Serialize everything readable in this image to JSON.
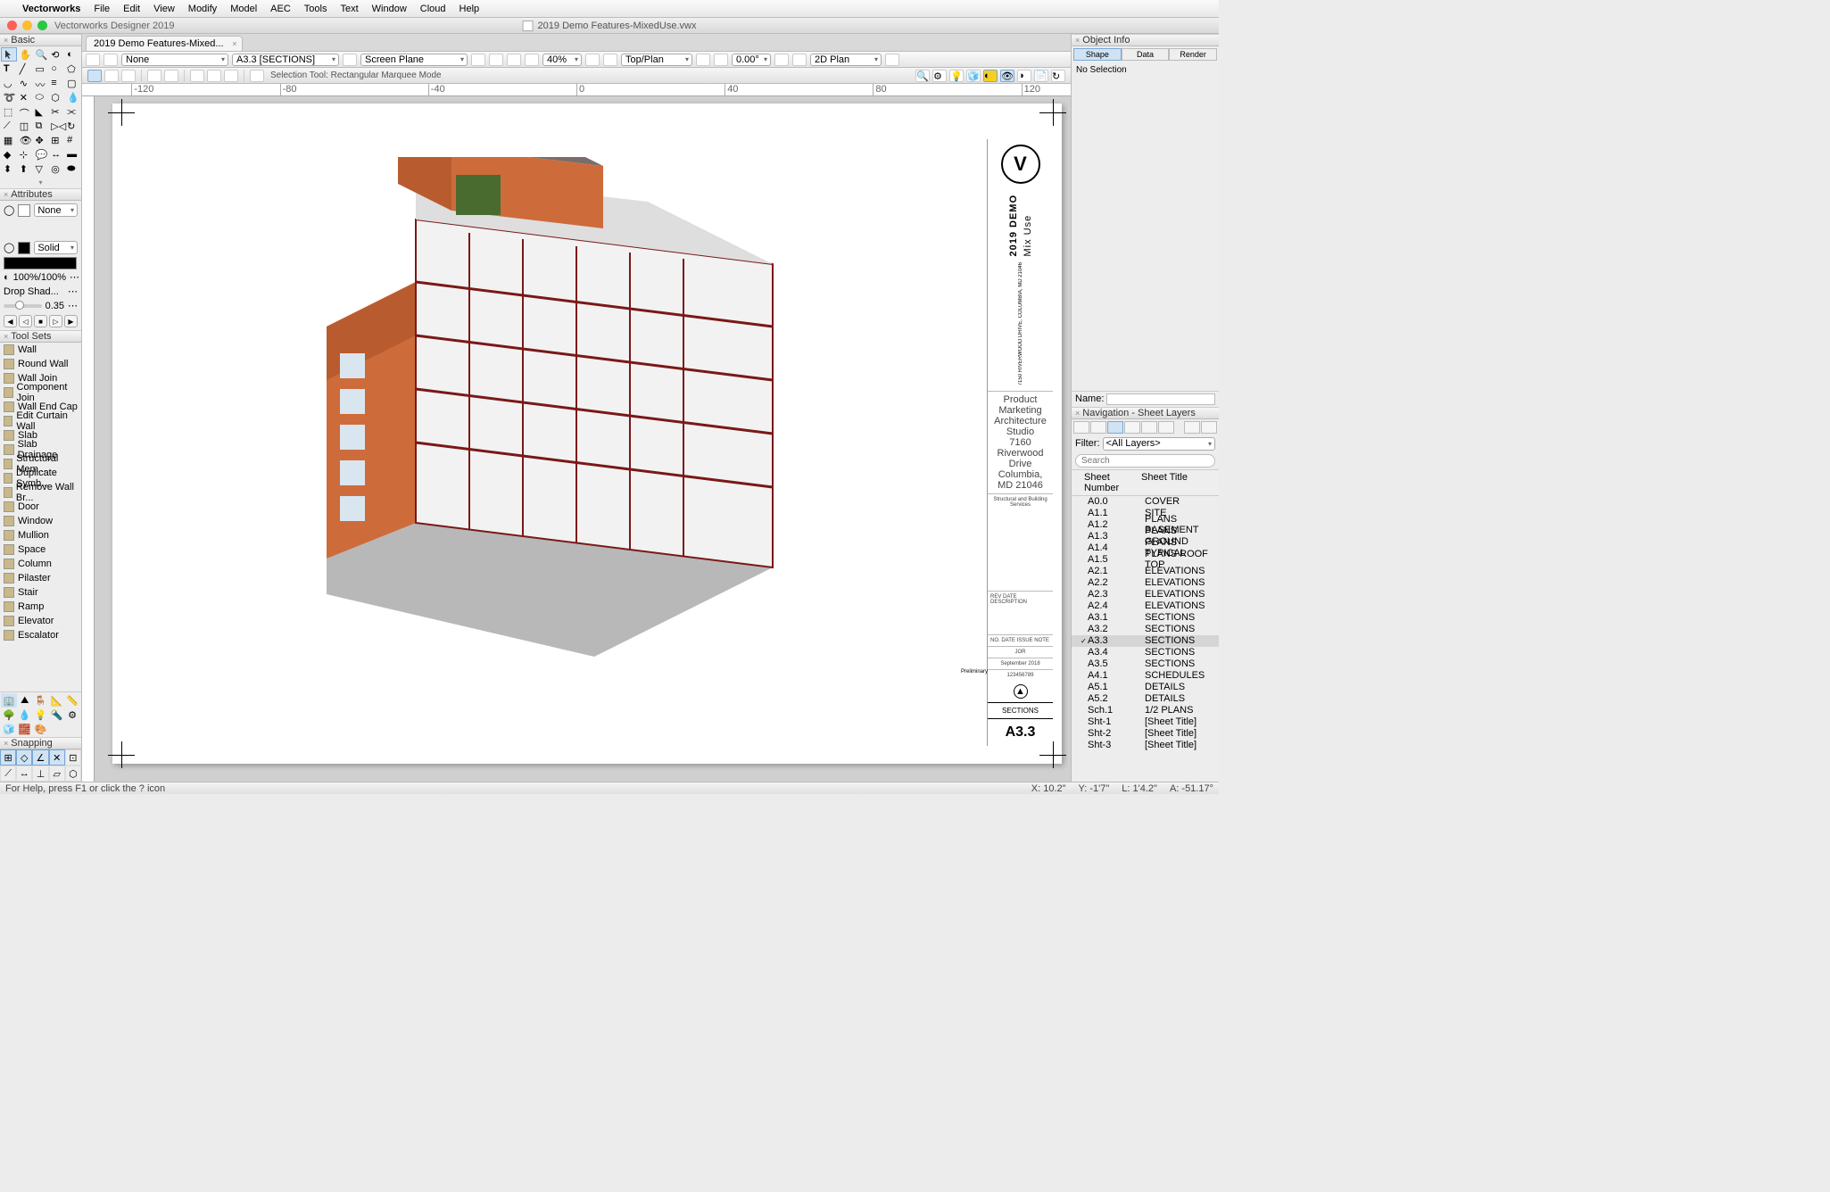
{
  "menubar": {
    "app": "Vectorworks",
    "items": [
      "File",
      "Edit",
      "View",
      "Modify",
      "Model",
      "AEC",
      "Tools",
      "Text",
      "Window",
      "Cloud",
      "Help"
    ]
  },
  "window": {
    "app_title": "Vectorworks Designer 2019",
    "doc_title": "2019 Demo Features-MixedUse.vwx"
  },
  "doc_tab": "2019 Demo Features-Mixed...",
  "view_bar": {
    "class_drop": "None",
    "layer_drop": "A3.3 [SECTIONS]",
    "plane_drop": "Screen Plane",
    "zoom": "40%",
    "view_drop": "Top/Plan",
    "angle": "0.00°",
    "render_drop": "2D Plan"
  },
  "mode_bar": {
    "text": "Selection Tool: Rectangular Marquee Mode"
  },
  "palettes": {
    "basic": "Basic",
    "attributes": "Attributes",
    "toolsets": "Tool Sets",
    "snapping": "Snapping",
    "objectinfo": "Object Info",
    "navigation": "Navigation - Sheet Layers"
  },
  "attributes": {
    "fill_mode": "None",
    "pen_mode": "Solid",
    "opacity": "100%/100%",
    "drop_shadow": "Drop Shad...",
    "drop_val": "0.35"
  },
  "toolsets": [
    "Wall",
    "Round Wall",
    "Wall Join",
    "Component Join",
    "Wall End Cap",
    "Edit Curtain Wall",
    "Slab",
    "Slab Drainage",
    "Structural Mem...",
    "Duplicate Symb...",
    "Remove Wall Br...",
    "Door",
    "Window",
    "Mullion",
    "Space",
    "Column",
    "Pilaster",
    "Stair",
    "Ramp",
    "Elevator",
    "Escalator"
  ],
  "objectinfo": {
    "tabs": [
      "Shape",
      "Data",
      "Render"
    ],
    "no_selection": "No Selection",
    "name_label": "Name:"
  },
  "navigation": {
    "filter_label": "Filter:",
    "filter_value": "<All Layers>",
    "search_placeholder": "Search",
    "col1": "Sheet Number",
    "col2": "Sheet Title",
    "rows": [
      {
        "num": "A0.0",
        "title": "COVER"
      },
      {
        "num": "A1.1",
        "title": "SITE"
      },
      {
        "num": "A1.2",
        "title": "PLANS BASEMENT"
      },
      {
        "num": "A1.3",
        "title": "PLANS GROUND"
      },
      {
        "num": "A1.4",
        "title": "PLANS TYPICAL"
      },
      {
        "num": "A1.5",
        "title": "PLANS ROOF TOP"
      },
      {
        "num": "A2.1",
        "title": "ELEVATIONS"
      },
      {
        "num": "A2.2",
        "title": "ELEVATIONS"
      },
      {
        "num": "A2.3",
        "title": "ELEVATIONS"
      },
      {
        "num": "A2.4",
        "title": "ELEVATIONS"
      },
      {
        "num": "A3.1",
        "title": "SECTIONS"
      },
      {
        "num": "A3.2",
        "title": "SECTIONS"
      },
      {
        "num": "A3.3",
        "title": "SECTIONS",
        "active": true
      },
      {
        "num": "A3.4",
        "title": "SECTIONS"
      },
      {
        "num": "A3.5",
        "title": "SECTIONS"
      },
      {
        "num": "A4.1",
        "title": "SCHEDULES"
      },
      {
        "num": "A5.1",
        "title": "DETAILS"
      },
      {
        "num": "A5.2",
        "title": "DETAILS"
      },
      {
        "num": "Sch.1",
        "title": "1/2 PLANS"
      },
      {
        "num": "Sht-1",
        "title": "[Sheet Title]"
      },
      {
        "num": "Sht-2",
        "title": "[Sheet Title]"
      },
      {
        "num": "Sht-3",
        "title": "[Sheet Title]"
      }
    ]
  },
  "title_block": {
    "project1": "2019 DEMO",
    "project2": "Mix Use",
    "address": "7150 RIVERWOOD DRIVE, COLUMBIA, MD 21046",
    "firm1": "Product Marketing",
    "firm2": "Architecture Studio",
    "firm3": "7160 Riverwood Drive",
    "firm4": "Columbia, MD 21046",
    "consultant": "Structural and Building Services",
    "rev_hdr": "REV   DATE   DESCRIPTION",
    "issue_hdr": "NO.   DATE   ISSUE NOTE",
    "date": "September 2018",
    "proj_num": "123456789",
    "status": "Preliminary",
    "sheet_name": "SECTIONS",
    "sheet_num": "A3.3",
    "jor": "JOR"
  },
  "status": {
    "help": "For Help, press F1 or click the ? icon",
    "x": "X: 10.2\"",
    "y": "Y: -1'7\"",
    "l": "L: 1'4.2\"",
    "a": "A: -51.17°"
  }
}
